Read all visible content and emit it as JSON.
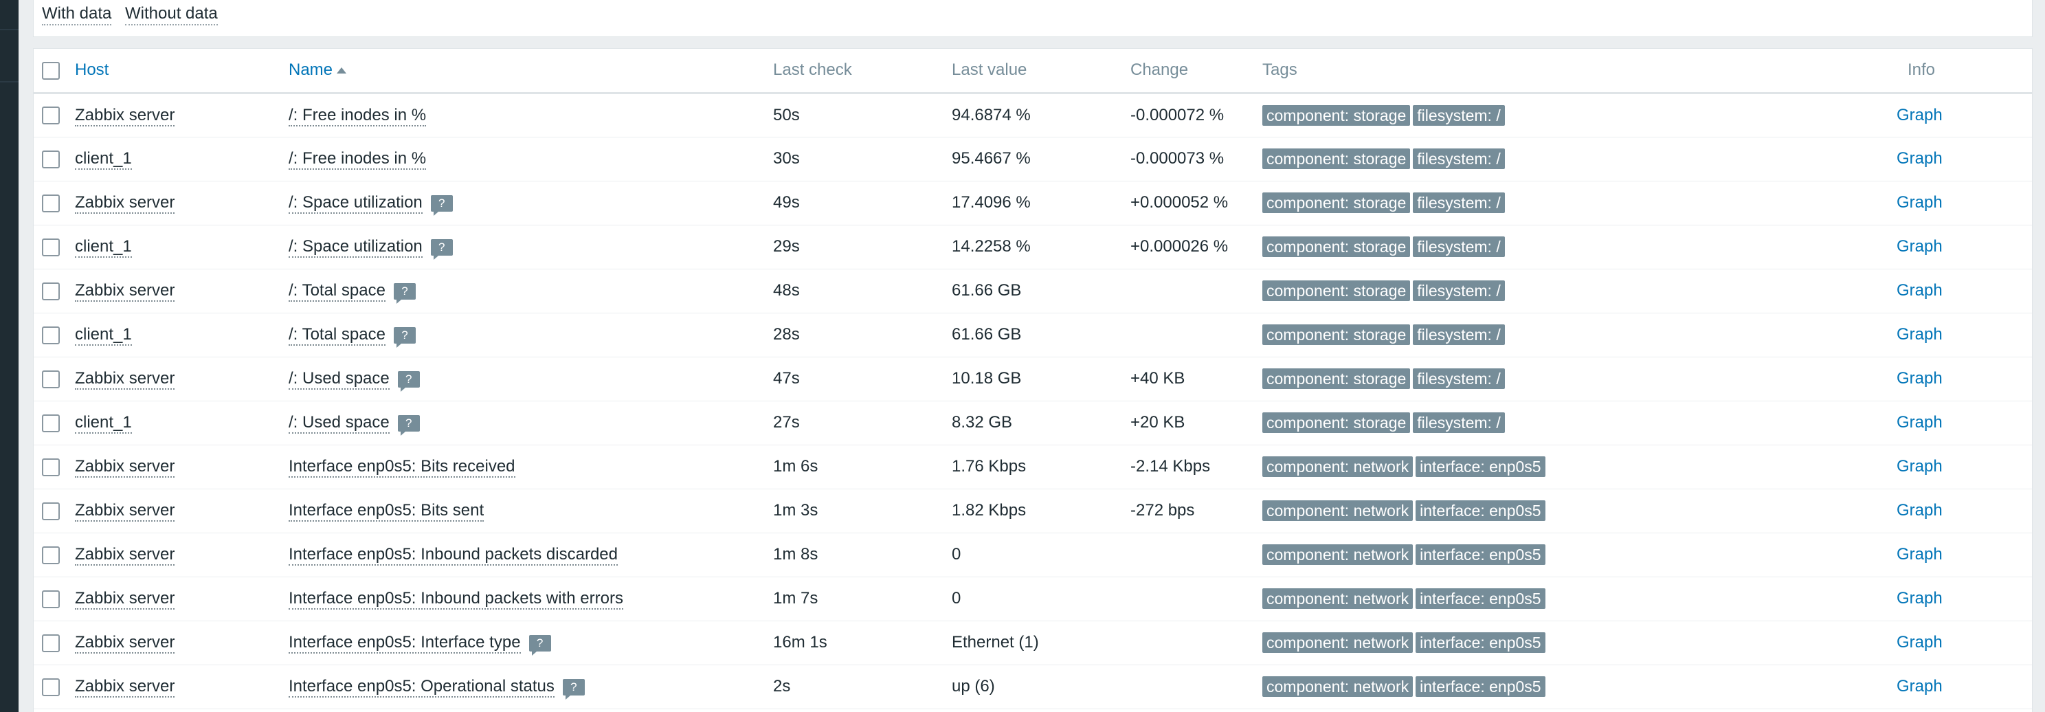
{
  "filter_tabs": [
    "With data",
    "Without data"
  ],
  "table": {
    "headers": {
      "host": "Host",
      "name": "Name",
      "last_check": "Last check",
      "last_value": "Last value",
      "change": "Change",
      "tags": "Tags",
      "info": "Info"
    },
    "sort": {
      "column": "name",
      "direction": "ascending"
    },
    "hint_icon_text": "?",
    "rows": [
      {
        "host": "Zabbix server",
        "name": "/: Free inodes in %",
        "hint": false,
        "last_check": "50s",
        "last_value": "94.6874 %",
        "change": "-0.000072 %",
        "tags": [
          "component: storage",
          "filesystem: /"
        ],
        "action": "Graph"
      },
      {
        "host": "client_1",
        "name": "/: Free inodes in %",
        "hint": false,
        "last_check": "30s",
        "last_value": "95.4667 %",
        "change": "-0.000073 %",
        "tags": [
          "component: storage",
          "filesystem: /"
        ],
        "action": "Graph"
      },
      {
        "host": "Zabbix server",
        "name": "/: Space utilization",
        "hint": true,
        "last_check": "49s",
        "last_value": "17.4096 %",
        "change": "+0.000052 %",
        "tags": [
          "component: storage",
          "filesystem: /"
        ],
        "action": "Graph"
      },
      {
        "host": "client_1",
        "name": "/: Space utilization",
        "hint": true,
        "last_check": "29s",
        "last_value": "14.2258 %",
        "change": "+0.000026 %",
        "tags": [
          "component: storage",
          "filesystem: /"
        ],
        "action": "Graph"
      },
      {
        "host": "Zabbix server",
        "name": "/: Total space",
        "hint": true,
        "last_check": "48s",
        "last_value": "61.66 GB",
        "change": "",
        "tags": [
          "component: storage",
          "filesystem: /"
        ],
        "action": "Graph"
      },
      {
        "host": "client_1",
        "name": "/: Total space",
        "hint": true,
        "last_check": "28s",
        "last_value": "61.66 GB",
        "change": "",
        "tags": [
          "component: storage",
          "filesystem: /"
        ],
        "action": "Graph"
      },
      {
        "host": "Zabbix server",
        "name": "/: Used space",
        "hint": true,
        "last_check": "47s",
        "last_value": "10.18 GB",
        "change": "+40 KB",
        "tags": [
          "component: storage",
          "filesystem: /"
        ],
        "action": "Graph"
      },
      {
        "host": "client_1",
        "name": "/: Used space",
        "hint": true,
        "last_check": "27s",
        "last_value": "8.32 GB",
        "change": "+20 KB",
        "tags": [
          "component: storage",
          "filesystem: /"
        ],
        "action": "Graph"
      },
      {
        "host": "Zabbix server",
        "name": "Interface enp0s5: Bits received",
        "hint": false,
        "last_check": "1m 6s",
        "last_value": "1.76 Kbps",
        "change": "-2.14 Kbps",
        "tags": [
          "component: network",
          "interface: enp0s5"
        ],
        "action": "Graph"
      },
      {
        "host": "Zabbix server",
        "name": "Interface enp0s5: Bits sent",
        "hint": false,
        "last_check": "1m 3s",
        "last_value": "1.82 Kbps",
        "change": "-272 bps",
        "tags": [
          "component: network",
          "interface: enp0s5"
        ],
        "action": "Graph"
      },
      {
        "host": "Zabbix server",
        "name": "Interface enp0s5: Inbound packets discarded",
        "hint": false,
        "last_check": "1m 8s",
        "last_value": "0",
        "change": "",
        "tags": [
          "component: network",
          "interface: enp0s5"
        ],
        "action": "Graph"
      },
      {
        "host": "Zabbix server",
        "name": "Interface enp0s5: Inbound packets with errors",
        "hint": false,
        "last_check": "1m 7s",
        "last_value": "0",
        "change": "",
        "tags": [
          "component: network",
          "interface: enp0s5"
        ],
        "action": "Graph"
      },
      {
        "host": "Zabbix server",
        "name": "Interface enp0s5: Interface type",
        "hint": true,
        "last_check": "16m 1s",
        "last_value": "Ethernet (1)",
        "change": "",
        "tags": [
          "component: network",
          "interface: enp0s5"
        ],
        "action": "Graph"
      },
      {
        "host": "Zabbix server",
        "name": "Interface enp0s5: Operational status",
        "hint": true,
        "last_check": "2s",
        "last_value": "up (6)",
        "change": "",
        "tags": [
          "component: network",
          "interface: enp0s5"
        ],
        "action": "Graph"
      }
    ]
  },
  "colors": {
    "link": "#0275b8",
    "tag_bg": "#768d99",
    "sidebar": "#1f2c33"
  }
}
